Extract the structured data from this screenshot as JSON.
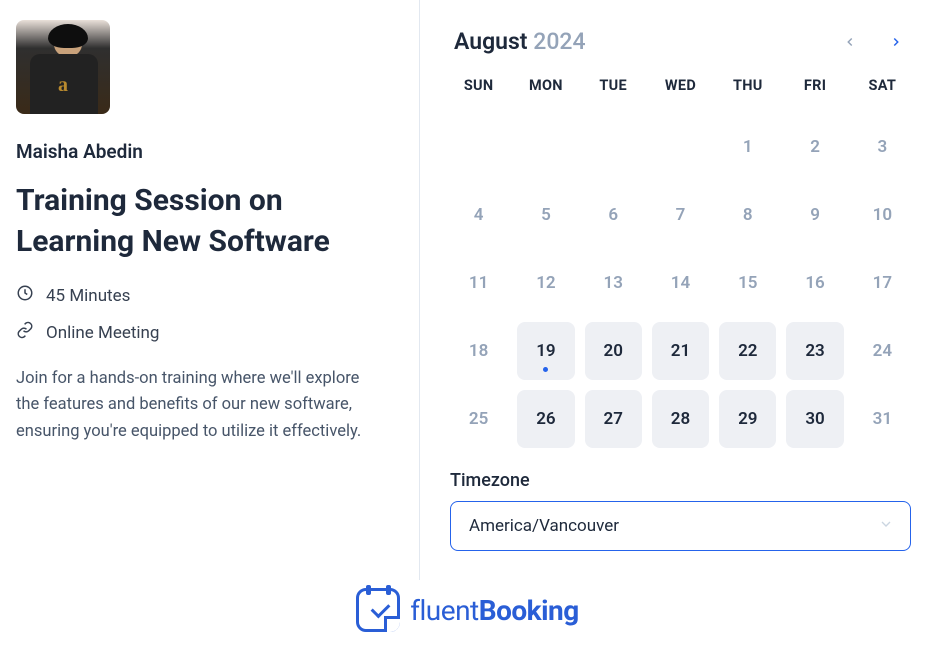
{
  "host": {
    "name": "Maisha Abedin"
  },
  "event": {
    "title": "Training Session on Learning New Software",
    "duration": "45 Minutes",
    "location": "Online Meeting",
    "description": "Join for a hands-on training where we'll explore the features and benefits of our new software, ensuring you're equipped to utilize it effectively."
  },
  "calendar": {
    "month": "August",
    "year": "2024",
    "dow": [
      "SUN",
      "MON",
      "TUE",
      "WED",
      "THU",
      "FRI",
      "SAT"
    ],
    "days": [
      {
        "n": "",
        "state": "empty"
      },
      {
        "n": "",
        "state": "empty"
      },
      {
        "n": "",
        "state": "empty"
      },
      {
        "n": "",
        "state": "empty"
      },
      {
        "n": "1",
        "state": "disabled"
      },
      {
        "n": "2",
        "state": "disabled"
      },
      {
        "n": "3",
        "state": "disabled"
      },
      {
        "n": "4",
        "state": "disabled"
      },
      {
        "n": "5",
        "state": "disabled"
      },
      {
        "n": "6",
        "state": "disabled"
      },
      {
        "n": "7",
        "state": "disabled"
      },
      {
        "n": "8",
        "state": "disabled"
      },
      {
        "n": "9",
        "state": "disabled"
      },
      {
        "n": "10",
        "state": "disabled"
      },
      {
        "n": "11",
        "state": "disabled"
      },
      {
        "n": "12",
        "state": "disabled"
      },
      {
        "n": "13",
        "state": "disabled"
      },
      {
        "n": "14",
        "state": "disabled"
      },
      {
        "n": "15",
        "state": "disabled"
      },
      {
        "n": "16",
        "state": "disabled"
      },
      {
        "n": "17",
        "state": "disabled"
      },
      {
        "n": "18",
        "state": "disabled"
      },
      {
        "n": "19",
        "state": "avail",
        "today": true
      },
      {
        "n": "20",
        "state": "avail"
      },
      {
        "n": "21",
        "state": "avail"
      },
      {
        "n": "22",
        "state": "avail"
      },
      {
        "n": "23",
        "state": "avail"
      },
      {
        "n": "24",
        "state": "disabled"
      },
      {
        "n": "25",
        "state": "disabled"
      },
      {
        "n": "26",
        "state": "avail"
      },
      {
        "n": "27",
        "state": "avail"
      },
      {
        "n": "28",
        "state": "avail"
      },
      {
        "n": "29",
        "state": "avail"
      },
      {
        "n": "30",
        "state": "avail"
      },
      {
        "n": "31",
        "state": "disabled"
      }
    ]
  },
  "timezone": {
    "label": "Timezone",
    "selected": "America/Vancouver"
  },
  "branding": {
    "text_light": "fluent",
    "text_bold": "Booking"
  }
}
